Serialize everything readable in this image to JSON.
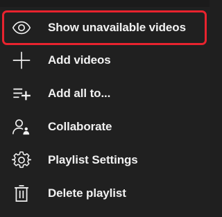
{
  "menu": {
    "items": [
      {
        "label": "Show unavailable videos",
        "icon": "eye-icon"
      },
      {
        "label": "Add videos",
        "icon": "plus-icon"
      },
      {
        "label": "Add all to...",
        "icon": "playlist-add-icon"
      },
      {
        "label": "Collaborate",
        "icon": "person-add-icon"
      },
      {
        "label": "Playlist Settings",
        "icon": "gear-icon"
      },
      {
        "label": "Delete playlist",
        "icon": "trash-icon"
      }
    ],
    "highlight_color": "#e8232e",
    "background_color": "#202020",
    "text_color": "#f1f1f1"
  }
}
